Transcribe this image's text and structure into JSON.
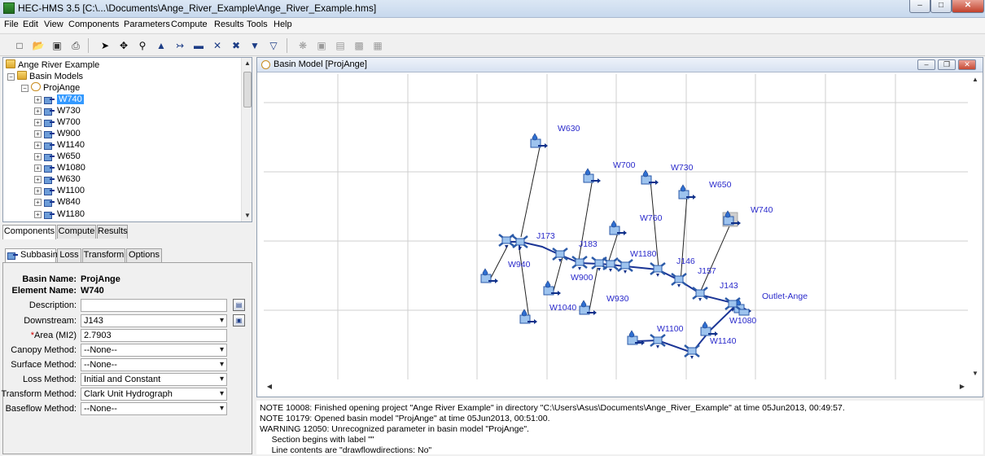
{
  "window": {
    "title": "HEC-HMS 3.5 [C:\\...\\Documents\\Ange_River_Example\\Ange_River_Example.hms]",
    "minimize": "–",
    "maximize": "□",
    "close": "✕"
  },
  "menu": [
    "File",
    "Edit",
    "View",
    "Components",
    "Parameters",
    "Compute",
    "Results",
    "Tools",
    "Help"
  ],
  "toolbar": {
    "icons": [
      "new-file-icon",
      "open-folder-icon",
      "save-icon",
      "print-icon",
      "arrow-select-icon",
      "move-icon",
      "zoom-icon",
      "subbasin-tool-icon",
      "reach-tool-icon",
      "reservoir-tool-icon",
      "junction-tool-icon",
      "diversion-tool-icon",
      "source-tool-icon",
      "sink-tool-icon",
      "compute-icon",
      "results-icon",
      "graph-icon",
      "summary-icon",
      "table-icon"
    ]
  },
  "tree": {
    "root": "Ange River Example",
    "basin_models": "Basin Models",
    "model": "ProjAnge",
    "elements": [
      "W740",
      "W730",
      "W700",
      "W900",
      "W1140",
      "W650",
      "W1080",
      "W630",
      "W1100",
      "W840",
      "W1180"
    ],
    "selected": "W740"
  },
  "tree_tabs": [
    "Components",
    "Compute",
    "Results"
  ],
  "prop_tabs": [
    "Subbasin",
    "Loss",
    "Transform",
    "Options"
  ],
  "properties": {
    "basin_name_label": "Basin Name:",
    "basin_name": "ProjAnge",
    "element_name_label": "Element Name:",
    "element_name": "W740",
    "description_label": "Description:",
    "description": "",
    "downstream_label": "Downstream:",
    "downstream": "J143",
    "area_asterisk": "*",
    "area_label": "Area (MI2)",
    "area": "2.7903",
    "canopy_label": "Canopy Method:",
    "canopy": "--None--",
    "surface_label": "Surface Method:",
    "surface": "--None--",
    "loss_label": "Loss Method:",
    "loss": "Initial and Constant",
    "transform_label": "Transform Method:",
    "transform": "Clark Unit Hydrograph",
    "baseflow_label": "Baseflow Method:",
    "baseflow": "--None--"
  },
  "basin_window": {
    "title": "Basin Model [ProjAnge]",
    "labels": {
      "W630": "W630",
      "W700": "W700",
      "W730": "W730",
      "W650": "W650",
      "W740": "W740",
      "W760": "W760",
      "J173": "J173",
      "J183": "J183",
      "W1180": "W1180",
      "J146": "J146",
      "J157": "J157",
      "J143": "J143",
      "Outlet": "Outlet-Ange",
      "W940": "W940",
      "W900": "W900",
      "W930": "W930",
      "W1040": "W1040",
      "W1100": "W1100",
      "W1140": "W1140",
      "W1080": "W1080"
    }
  },
  "messages": [
    "NOTE 10008:  Finished opening project \"Ange River Example\" in directory \"C:\\Users\\Asus\\Documents\\Ange_River_Example\" at time 05Jun2013, 00:49:57.",
    "NOTE 10179:  Opened basin model \"ProjAnge\" at time 05Jun2013, 00:51:00.",
    "WARNING 12050:  Unrecognized parameter in basin model \"ProjAnge\".",
    "     Section begins with label \"\"",
    "     Line contents are \"drawflowdirections: No\""
  ]
}
